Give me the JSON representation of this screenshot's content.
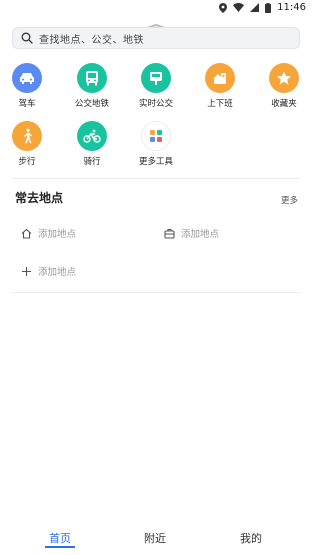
{
  "status_bar": {
    "time": "11:46"
  },
  "search": {
    "placeholder": "查找地点、公交、地铁"
  },
  "tools": [
    {
      "label": "驾车",
      "icon": "car-icon",
      "color": "#5b8bf0"
    },
    {
      "label": "公交地铁",
      "icon": "bus-icon",
      "color": "#19c3a0"
    },
    {
      "label": "实时公交",
      "icon": "realtime-bus-icon",
      "color": "#19c3a0"
    },
    {
      "label": "上下班",
      "icon": "commute-icon",
      "color": "#f5a53a"
    },
    {
      "label": "收藏夹",
      "icon": "star-icon",
      "color": "#f5a53a"
    },
    {
      "label": "步行",
      "icon": "walk-icon",
      "color": "#f5a53a"
    },
    {
      "label": "骑行",
      "icon": "bike-icon",
      "color": "#19c3a0"
    },
    {
      "label": "更多工具",
      "icon": "grid-icon",
      "color": "#ffffff"
    }
  ],
  "frequent": {
    "title": "常去地点",
    "more": "更多",
    "home_label": "添加地点",
    "work_label": "添加地点",
    "add_label": "添加地点"
  },
  "nav": {
    "home": "首页",
    "nearby": "附近",
    "mine": "我的"
  },
  "colors": {
    "accent": "#2f6ee6"
  }
}
